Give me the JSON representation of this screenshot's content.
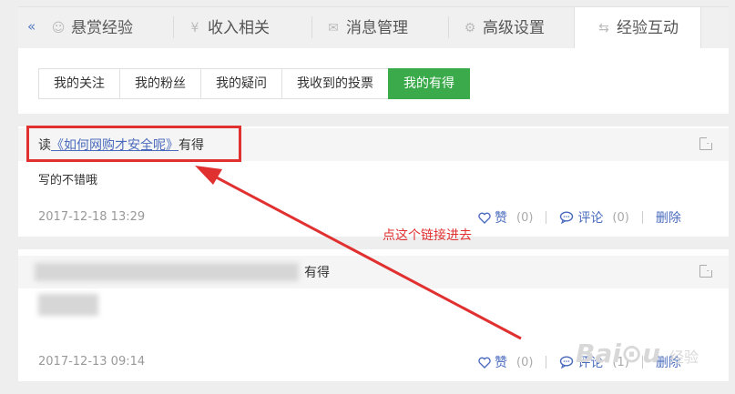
{
  "tabs": [
    {
      "label": "悬赏经验",
      "icon": "medal-icon",
      "glyph": "☺"
    },
    {
      "label": "收入相关",
      "icon": "yen-icon",
      "glyph": "¥"
    },
    {
      "label": "消息管理",
      "icon": "mail-icon",
      "glyph": "✉"
    },
    {
      "label": "高级设置",
      "icon": "gear-icon",
      "glyph": "⚙"
    },
    {
      "label": "经验互动",
      "icon": "swap-icon",
      "glyph": "⇆"
    }
  ],
  "collapse_glyph": "«",
  "subtabs": [
    "我的关注",
    "我的粉丝",
    "我的疑问",
    "我收到的投票",
    "我的有得"
  ],
  "active_subtab": "我的有得",
  "cards": [
    {
      "title_prefix": "读",
      "title_link": "《如何网购才安全呢》",
      "title_suffix": "有得",
      "body": "写的不错哦",
      "date": "2017-12-18 13:29",
      "like_label": "赞",
      "like_count": "(0)",
      "comment_label": "评论",
      "comment_count": "(0)",
      "delete_label": "删除"
    },
    {
      "title_suffix": "有得",
      "date": "2017-12-13 09:14",
      "like_label": "赞",
      "like_count": "(0)",
      "comment_label": "评论",
      "comment_count": "(1)",
      "delete_label": "删除"
    }
  ],
  "annotation": "点这个链接进去",
  "colors": {
    "accent_green": "#3aaa4a",
    "link_blue": "#4a6bbd",
    "annotation_red": "#e03030"
  }
}
